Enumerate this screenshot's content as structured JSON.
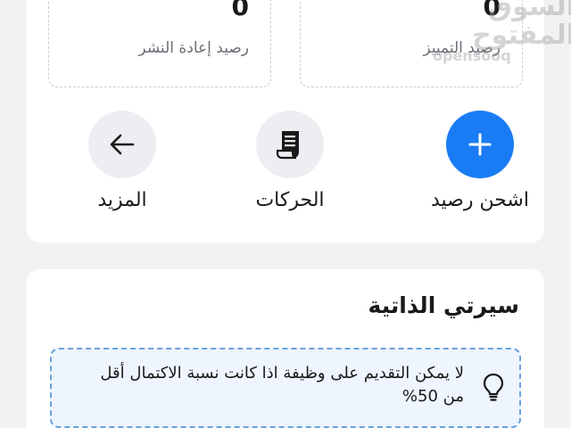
{
  "wallet": {
    "featured_balance": {
      "value": "0",
      "label": "رصيد التمييز"
    },
    "repost_balance": {
      "value": "0",
      "label": "رصيد إعادة النشر"
    },
    "watermark": {
      "arabic": "السوق المفتوح",
      "latin": "opensooq"
    },
    "actions": {
      "topup": {
        "label": "اشحن رصيد",
        "icon": "plus-icon"
      },
      "transactions": {
        "label": "الحركات",
        "icon": "receipt-icon"
      },
      "more": {
        "label": "المزيد",
        "icon": "arrow-left-icon"
      }
    },
    "colors": {
      "accent": "#1a7cf5",
      "icon_bg": "#eceef1"
    }
  },
  "cv": {
    "title": "سيرتي الذاتية",
    "notice": {
      "icon": "lightbulb-icon",
      "text": "لا يمكن التقديم على وظيفة اذا كانت نسبة الاكتمال أقل من 50%"
    }
  }
}
